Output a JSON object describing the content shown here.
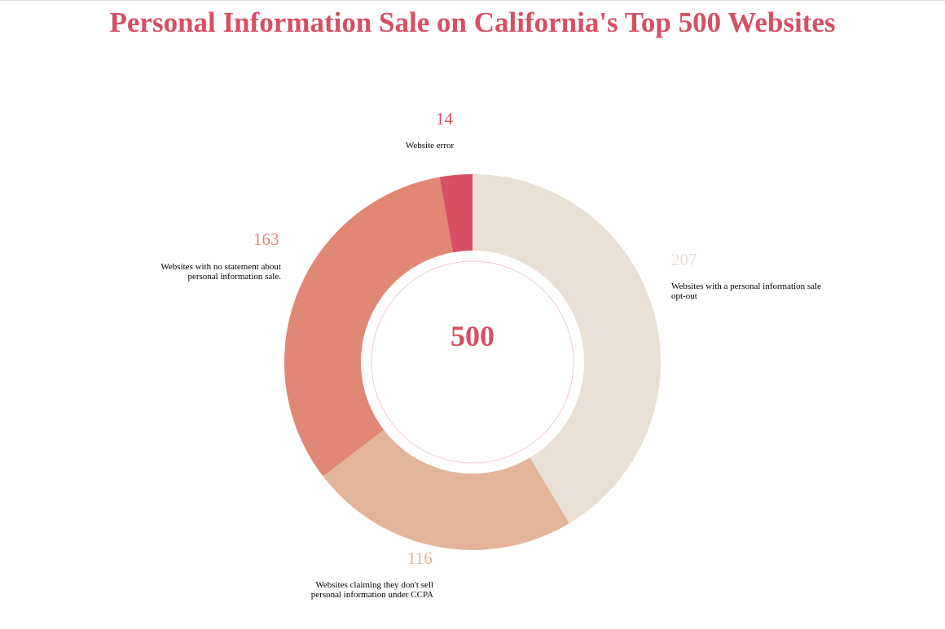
{
  "title": "Personal Information Sale on California's Top 500 Websites",
  "chart_data": {
    "type": "pie",
    "total": 500,
    "center_label": "500",
    "start": "top",
    "direction": "clockwise",
    "series": [
      {
        "value": 207,
        "value_label": "207",
        "label": "Websites with a personal information sale opt-out",
        "color": "#e8e0d5"
      },
      {
        "value": 116,
        "value_label": "116",
        "label": "Websites claiming they don't sell personal information under CCPA",
        "color": "#e2b59a"
      },
      {
        "value": 163,
        "value_label": "163",
        "label": "Websites with no statement about personal information sale.",
        "color": "#e08776"
      },
      {
        "value": 14,
        "value_label": "14",
        "label": "Website error",
        "color": "#d94f66"
      }
    ]
  }
}
